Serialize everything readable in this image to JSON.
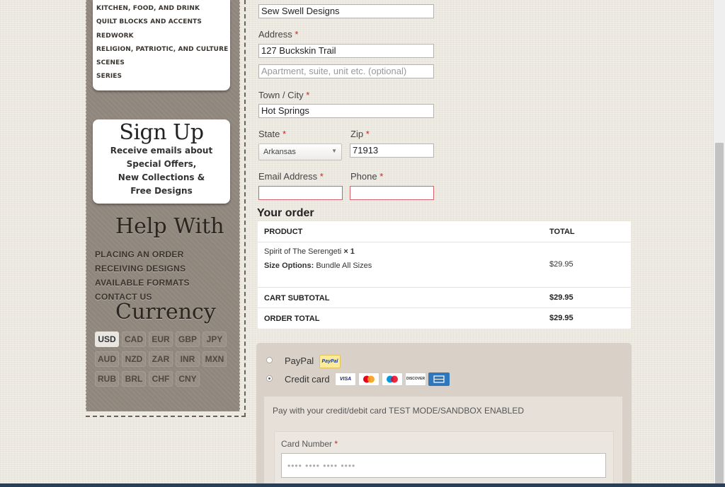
{
  "sidebar": {
    "categories": [
      "KITCHEN, FOOD, AND DRINK",
      "QUILT BLOCKS AND ACCENTS",
      "REDWORK",
      "RELIGION, PATRIOTIC, AND CULTURE",
      "SCENES",
      "SERIES"
    ],
    "signup": {
      "title": "Sign Up",
      "lines": [
        "Receive emails about",
        "Special Offers,",
        "New Collections &",
        "Free Designs"
      ]
    },
    "help": {
      "title": "Help With",
      "links": [
        "PLACING AN ORDER",
        "RECEIVING DESIGNS",
        "AVAILABLE FORMATS",
        "CONTACT US"
      ]
    },
    "currency": {
      "title": "Currency",
      "options": [
        "USD",
        "CAD",
        "EUR",
        "GBP",
        "JPY",
        "AUD",
        "NZD",
        "ZAR",
        "INR",
        "MXN",
        "RUB",
        "BRL",
        "CHF",
        "CNY"
      ],
      "active": "USD"
    }
  },
  "form": {
    "company_value": "Sew Swell Designs",
    "address_label": "Address",
    "address_value": "127 Buckskin Trail",
    "address2_placeholder": "Apartment, suite, unit etc. (optional)",
    "city_label": "Town / City",
    "city_value": "Hot Springs",
    "state_label": "State",
    "state_value": "Arkansas",
    "zip_label": "Zip",
    "zip_value": "71913",
    "email_label": "Email Address",
    "email_value": "",
    "phone_label": "Phone",
    "phone_value": "",
    "required_mark": "*"
  },
  "order": {
    "title": "Your order",
    "header_product": "PRODUCT",
    "header_total": "TOTAL",
    "item_name": "Spirit of The Serengeti",
    "item_qty": "× 1",
    "option_label": "Size Options:",
    "option_value": "Bundle All Sizes",
    "item_total": "$29.95",
    "subtotal_label": "CART SUBTOTAL",
    "subtotal_value": "$29.95",
    "total_label": "ORDER TOTAL",
    "total_value": "$29.95"
  },
  "payment": {
    "paypal_label": "PayPal",
    "paypal_logo": "PayPal",
    "card_label": "Credit card",
    "card_logos": [
      "VISA",
      "MC",
      "MAESTRO",
      "DISCOVER",
      "AMEX"
    ],
    "selected": "card",
    "note": "Pay with your credit/debit card TEST MODE/SANDBOX ENABLED",
    "card_number_label": "Card Number",
    "card_number_placeholder": "•••• •••• •••• ••••"
  },
  "colors": {
    "sidebar_bg": "#8f867c",
    "required": "#c0292a",
    "error_border": "#d8606a",
    "payment_bg": "#d9d1c7"
  }
}
